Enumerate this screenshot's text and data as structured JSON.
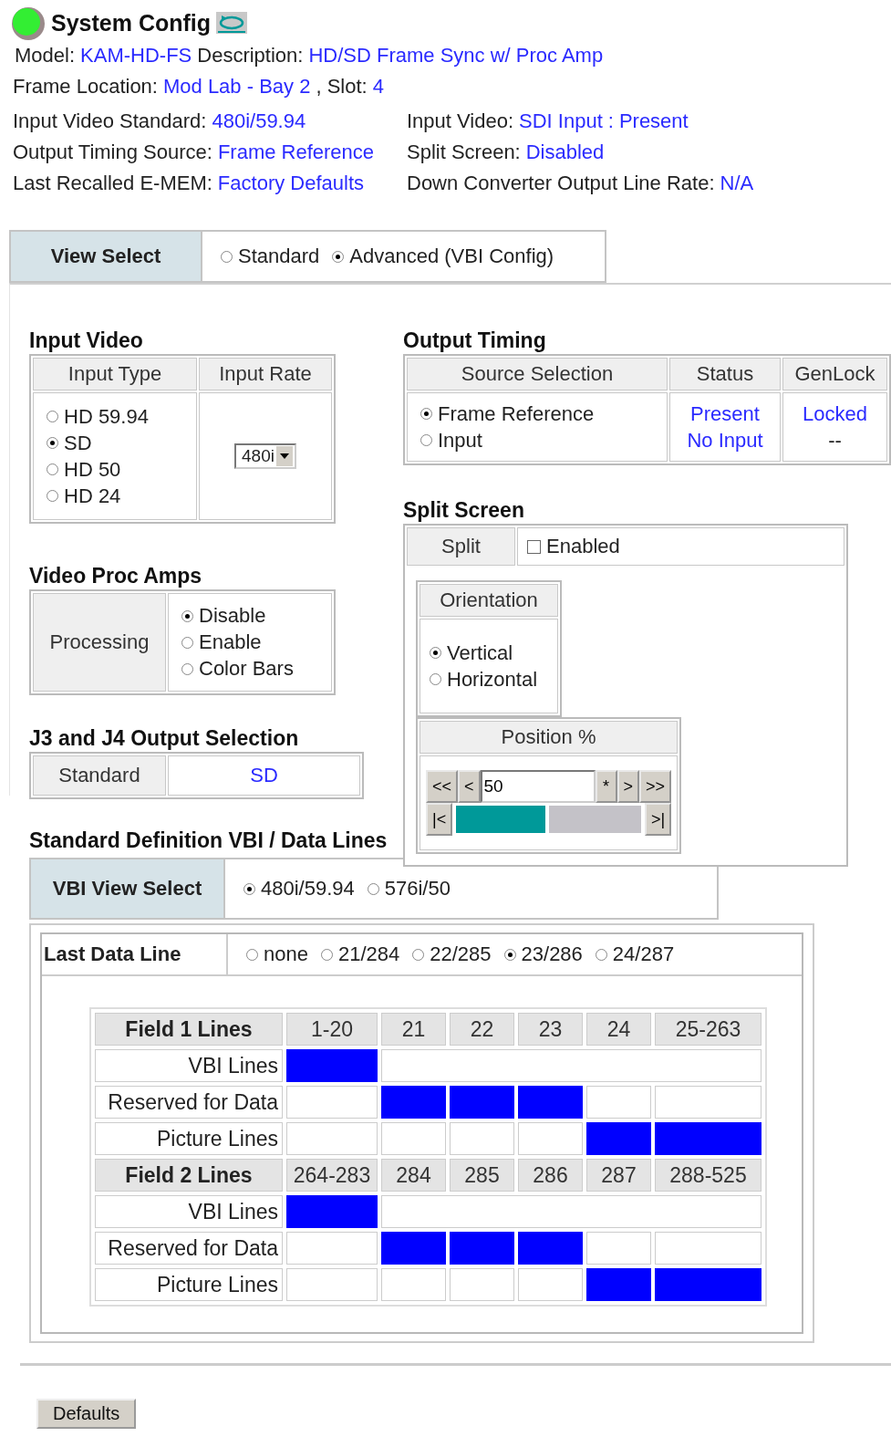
{
  "header": {
    "title": "System Config"
  },
  "info": {
    "line1": [
      {
        "label": "Model:",
        "value": "KAM-HD-FS"
      },
      {
        "label": "Description:",
        "value": "HD/SD Frame Sync w/ Proc Amp"
      }
    ],
    "line2": [
      {
        "label": "Frame Location:",
        "value": "Mod Lab - Bay 2"
      },
      {
        "label": ", Slot:",
        "value": "4"
      }
    ],
    "left": [
      {
        "label": "Input Video Standard:",
        "value": "480i/59.94"
      },
      {
        "label": "Output Timing Source:",
        "value": "Frame Reference"
      },
      {
        "label": "Last Recalled E-MEM:",
        "value": "Factory Defaults"
      }
    ],
    "right": [
      {
        "label": "Input Video:",
        "values": [
          "SDI Input",
          ":",
          "Present"
        ]
      },
      {
        "label": "Split Screen:",
        "values": [
          "Disabled"
        ]
      },
      {
        "label": "Down Converter Output Line Rate:",
        "values": [
          "N/A"
        ]
      }
    ]
  },
  "view_select": {
    "label": "View Select",
    "options": [
      {
        "label": "Standard",
        "selected": false
      },
      {
        "label": "Advanced (VBI Config)",
        "selected": true
      }
    ]
  },
  "input_video": {
    "title": "Input Video",
    "columns": [
      "Input Type",
      "Input Rate"
    ],
    "types": [
      {
        "label": "HD 59.94",
        "selected": false
      },
      {
        "label": "SD",
        "selected": true
      },
      {
        "label": "HD 50",
        "selected": false
      },
      {
        "label": "HD 24",
        "selected": false
      }
    ],
    "rate": "480i"
  },
  "output_timing": {
    "title": "Output Timing",
    "columns": [
      "Source Selection",
      "Status",
      "GenLock"
    ],
    "rows": [
      {
        "source": "Frame Reference",
        "selected": true,
        "status": "Present",
        "genlock": "Locked",
        "genlock_link": true
      },
      {
        "source": "Input",
        "selected": false,
        "status": "No Input",
        "genlock": "--",
        "genlock_link": false
      }
    ]
  },
  "split_screen": {
    "title": "Split Screen",
    "split_label": "Split",
    "enabled": {
      "label": "Enabled",
      "checked": false
    },
    "orientation": {
      "title": "Orientation",
      "options": [
        {
          "label": "Vertical",
          "selected": true
        },
        {
          "label": "Horizontal",
          "selected": false
        }
      ]
    },
    "position": {
      "title": "Position %",
      "value": "50",
      "level": 0.5,
      "row1_left": [
        "<<",
        "<"
      ],
      "row1_right": [
        "*",
        ">",
        ">>"
      ],
      "start": "|<",
      "end": ">|"
    }
  },
  "proc_amps": {
    "title": "Video Proc Amps",
    "label": "Processing",
    "options": [
      {
        "label": "Disable",
        "selected": true
      },
      {
        "label": "Enable",
        "selected": false
      },
      {
        "label": "Color Bars",
        "selected": false
      }
    ]
  },
  "j3j4": {
    "title": "J3 and J4 Output Selection",
    "label": "Standard",
    "value": "SD"
  },
  "vbi": {
    "title": "Standard Definition VBI / Data Lines",
    "view_select": {
      "label": "VBI View Select",
      "options": [
        {
          "label": "480i/59.94",
          "selected": true
        },
        {
          "label": "576i/50",
          "selected": false
        }
      ]
    },
    "last_data_line": {
      "label": "Last Data Line",
      "options": [
        {
          "label": "none",
          "selected": false
        },
        {
          "label": "21/284",
          "selected": false
        },
        {
          "label": "22/285",
          "selected": false
        },
        {
          "label": "23/286",
          "selected": true
        },
        {
          "label": "24/287",
          "selected": false
        }
      ]
    },
    "fields": [
      {
        "header": "Field 1 Lines",
        "columns": [
          "1-20",
          "21",
          "22",
          "23",
          "24",
          "25-263"
        ],
        "rows": [
          {
            "label": "VBI Lines",
            "cells": [
              true,
              false
            ]
          },
          {
            "label": "Reserved for Data",
            "cells": [
              false,
              true,
              true,
              true,
              false,
              false
            ]
          },
          {
            "label": "Picture Lines",
            "cells": [
              false,
              false,
              false,
              false,
              true,
              true
            ]
          }
        ]
      },
      {
        "header": "Field 2 Lines",
        "columns": [
          "264-283",
          "284",
          "285",
          "286",
          "287",
          "288-525"
        ],
        "rows": [
          {
            "label": "VBI Lines",
            "cells": [
              true,
              false
            ]
          },
          {
            "label": "Reserved for Data",
            "cells": [
              false,
              true,
              true,
              true,
              false,
              false
            ]
          },
          {
            "label": "Picture Lines",
            "cells": [
              false,
              false,
              false,
              false,
              true,
              true
            ]
          }
        ]
      }
    ]
  },
  "footer": {
    "button": "Defaults"
  }
}
